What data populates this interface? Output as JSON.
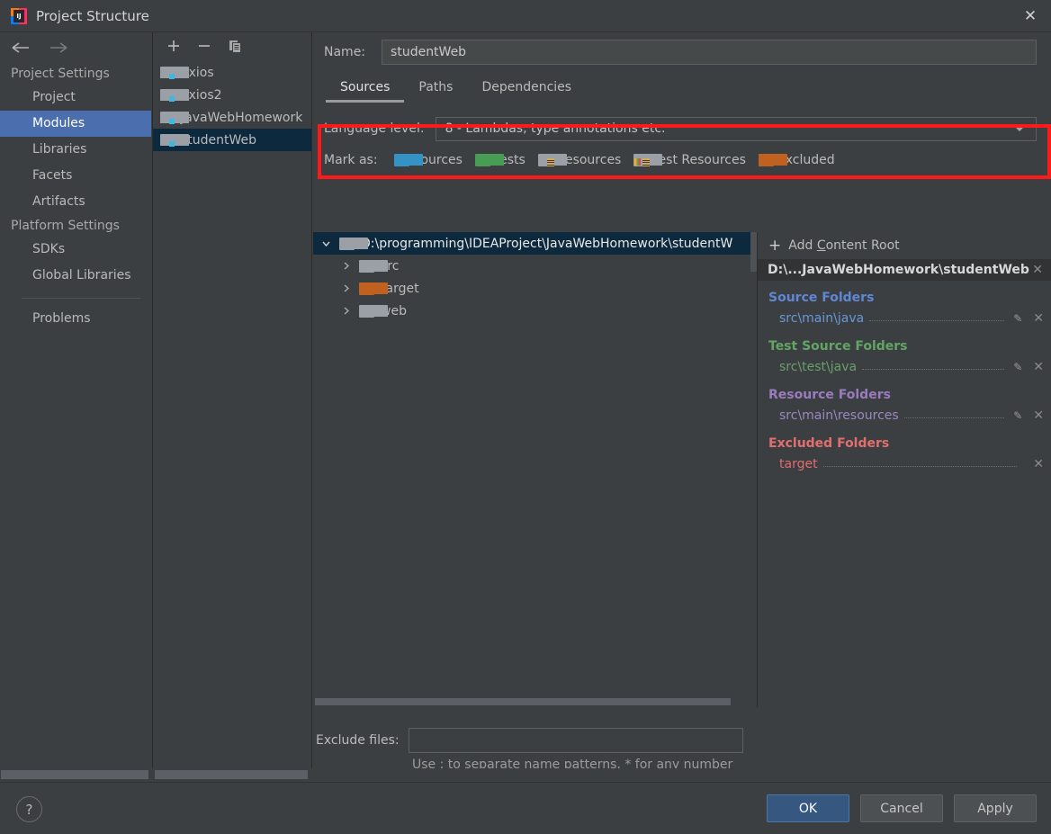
{
  "window": {
    "title": "Project Structure",
    "app_icon": "intellij-idea-icon",
    "close_label": "✕"
  },
  "nav": {
    "back_icon": "arrow-left-icon",
    "forward_icon": "arrow-right-icon",
    "groups": [
      {
        "label": "Project Settings",
        "items": [
          {
            "label": "Project",
            "selected": false
          },
          {
            "label": "Modules",
            "selected": true
          },
          {
            "label": "Libraries",
            "selected": false
          },
          {
            "label": "Facets",
            "selected": false
          },
          {
            "label": "Artifacts",
            "selected": false
          }
        ]
      },
      {
        "label": "Platform Settings",
        "items": [
          {
            "label": "SDKs",
            "selected": false
          },
          {
            "label": "Global Libraries",
            "selected": false
          }
        ]
      }
    ],
    "problems_label": "Problems"
  },
  "modules": {
    "toolbar": {
      "add_label": "+",
      "remove_label": "−",
      "copy_label": "copy-icon"
    },
    "items": [
      {
        "label": "axios",
        "selected": false
      },
      {
        "label": "axios2",
        "selected": false
      },
      {
        "label": "JavaWebHomework",
        "selected": false
      },
      {
        "label": "studentWeb",
        "selected": true
      }
    ]
  },
  "detail": {
    "name_label": "Name:",
    "name_value": "studentWeb",
    "name_placeholder": "",
    "tabs": [
      {
        "label": "Sources",
        "active": true
      },
      {
        "label": "Paths",
        "active": false
      },
      {
        "label": "Dependencies",
        "active": false
      }
    ],
    "language_level_label": "Language level:",
    "language_level_value": "8 - Lambdas, type annotations etc.",
    "mark_as_label": "Mark as:",
    "mark_as": [
      {
        "label": "Sources",
        "mnemonic": "S",
        "rest": "ources",
        "color": "blue"
      },
      {
        "label": "Tests",
        "mnemonic": "T",
        "rest": "ests",
        "color": "green"
      },
      {
        "label": "Resources",
        "mnemonic": "R",
        "rest": "esources",
        "color": "gray"
      },
      {
        "label": "Test Resources",
        "mnemonic": "T",
        "rest": "est Resources",
        "color": "testres"
      },
      {
        "label": "Excluded",
        "mnemonic": "E",
        "rest": "xcluded",
        "color": "orange"
      }
    ],
    "tree": [
      {
        "label": "D:\\programming\\IDEAProject\\JavaWebHomework\\studentW",
        "depth": 0,
        "twisty": "expanded",
        "folder": "gray",
        "selected": true
      },
      {
        "label": "src",
        "depth": 1,
        "twisty": "collapsed",
        "folder": "gray",
        "selected": false
      },
      {
        "label": "target",
        "depth": 1,
        "twisty": "collapsed",
        "folder": "orange",
        "selected": false
      },
      {
        "label": "web",
        "depth": 1,
        "twisty": "collapsed",
        "folder": "gray",
        "selected": false
      }
    ],
    "exclude_label": "Exclude files:",
    "exclude_value": "",
    "exclude_hint": "Use ; to separate name patterns, * for any number of symbols, ? for one."
  },
  "roots": {
    "add_content_root_label": "Add Content Root",
    "add_icon": "plus-icon",
    "header_path": "D:\\...JavaWebHomework\\studentWeb",
    "header_close_icon": "close-icon",
    "groups": [
      {
        "title": "Source Folders",
        "kind": "src",
        "entries": [
          {
            "path": "src\\main\\java",
            "has_edit": true,
            "has_remove": true
          }
        ]
      },
      {
        "title": "Test Source Folders",
        "kind": "test",
        "entries": [
          {
            "path": "src\\test\\java",
            "has_edit": true,
            "has_remove": true
          }
        ]
      },
      {
        "title": "Resource Folders",
        "kind": "res",
        "entries": [
          {
            "path": "src\\main\\resources",
            "has_edit": true,
            "has_remove": true
          }
        ]
      },
      {
        "title": "Excluded Folders",
        "kind": "exc",
        "entries": [
          {
            "path": "target",
            "has_edit": false,
            "has_remove": true
          }
        ]
      }
    ]
  },
  "footer": {
    "help_label": "?",
    "ok_label": "OK",
    "cancel_label": "Cancel",
    "apply_label": "Apply"
  },
  "colors": {
    "accent_selection": "#4b6eaf",
    "tree_selection": "#0d293e",
    "primary_button": "#365880",
    "annotation_red": "#ff1a1a",
    "source_blue": "#5f87d6",
    "test_green": "#62a564",
    "resource_purple": "#9b7bbf",
    "excluded_red": "#e26f6f"
  }
}
